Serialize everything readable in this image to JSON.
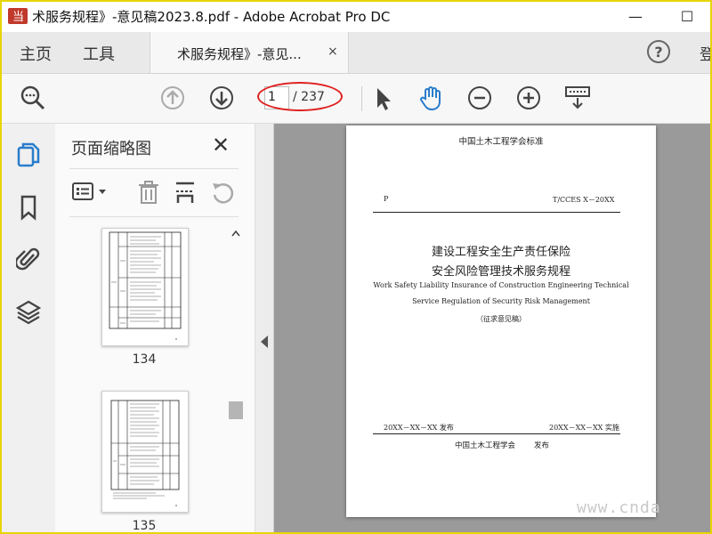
{
  "window": {
    "title": "术服务规程》-意见稿2023.8.pdf - Adobe Acrobat Pro DC",
    "logo_text": "当",
    "minimize": "—",
    "maximize": "☐"
  },
  "menu": {
    "home": "主页",
    "tools": "工具",
    "doc_tab_title": "术服务规程》-意见...",
    "doc_tab_close": "×",
    "help": "?",
    "signin_partial": "登"
  },
  "toolbar": {
    "current_page": "1",
    "total_pages": "/ 237"
  },
  "thumbnails": {
    "title": "页面缩略图",
    "close": "✕",
    "pages": [
      {
        "label": "134"
      },
      {
        "label": "135"
      }
    ]
  },
  "document": {
    "issuer_header": "中国土木工程学会标准",
    "code_prefix": "P",
    "standard_code": "T/CCES X－20XX",
    "title_cn_line1": "建设工程安全生产责任保险",
    "title_cn_line2": "安全风险管理技术服务规程",
    "title_en_line1": "Work Safety Liability Insurance of Construction Engineering Technical",
    "title_en_line2": "Service Regulation of Security Risk Management",
    "draft_note": "（征求意见稿）",
    "publish_date": "20XX－XX－XX 发布",
    "implement_date": "20XX－XX－XX 实施",
    "issuer_footer": "中国土木工程学会",
    "issuer_footer_action": "发布"
  },
  "watermark": "www.cnda",
  "colors": {
    "frame": "#e8d500",
    "annotation": "#e02020",
    "hand_tool": "#2a7ccc"
  }
}
